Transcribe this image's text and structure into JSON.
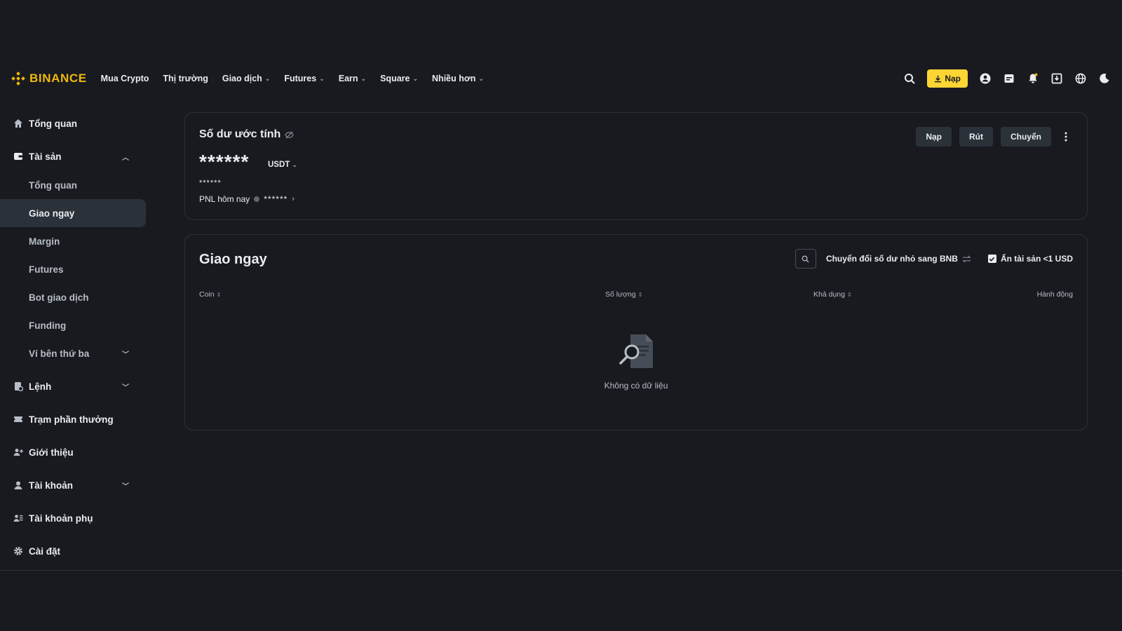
{
  "header": {
    "brand": "BINANCE",
    "nav": [
      {
        "label": "Mua Crypto",
        "dropdown": false
      },
      {
        "label": "Thị trường",
        "dropdown": false
      },
      {
        "label": "Giao dịch",
        "dropdown": true
      },
      {
        "label": "Futures",
        "dropdown": true
      },
      {
        "label": "Earn",
        "dropdown": true
      },
      {
        "label": "Square",
        "dropdown": true
      },
      {
        "label": "Nhiều hơn",
        "dropdown": true
      }
    ],
    "deposit_label": "Nạp",
    "icons": [
      "search-icon",
      "user-icon",
      "orders-icon",
      "bell-icon",
      "download-icon",
      "globe-icon",
      "moon-icon"
    ]
  },
  "sidebar": {
    "items": [
      {
        "label": "Tổng quan",
        "icon": "home-icon"
      },
      {
        "label": "Tài sản",
        "icon": "wallet-icon",
        "expanded": true
      },
      {
        "label": "Tổng quan"
      },
      {
        "label": "Giao ngay",
        "active": true
      },
      {
        "label": "Margin"
      },
      {
        "label": "Futures"
      },
      {
        "label": "Bot giao dịch"
      },
      {
        "label": "Funding"
      },
      {
        "label": "Ví bên thứ ba"
      },
      {
        "label": "Lệnh",
        "icon": "orders-icon"
      },
      {
        "label": "Trạm phần thưởng",
        "icon": "ticket-icon"
      },
      {
        "label": "Giới thiệu",
        "icon": "user-plus-icon"
      },
      {
        "label": "Tài khoản",
        "icon": "user-icon"
      },
      {
        "label": "Tài khoản phụ",
        "icon": "users-icon"
      },
      {
        "label": "Cài đặt",
        "icon": "gear-icon"
      }
    ]
  },
  "balance": {
    "title": "Số dư ước tính",
    "value": "******",
    "unit": "USDT",
    "sub_value": "******",
    "pnl_label": "PNL hôm nay",
    "pnl_value": "******",
    "actions": [
      "Nạp",
      "Rút",
      "Chuyển"
    ]
  },
  "spot": {
    "title": "Giao ngay",
    "convert_label": "Chuyển đổi số dư nhỏ sang BNB",
    "hide_small_label": "Ẩn tài sản <1 USD",
    "hide_small_checked": true,
    "columns": [
      "Coin",
      "Số lượng",
      "Khả dụng",
      "Hành động"
    ],
    "empty_text": "Không có dữ liệu"
  },
  "colors": {
    "bg": "#181a20",
    "accent": "#fcd535",
    "brand": "#f0b90b",
    "panel_border": "#2b3139"
  }
}
